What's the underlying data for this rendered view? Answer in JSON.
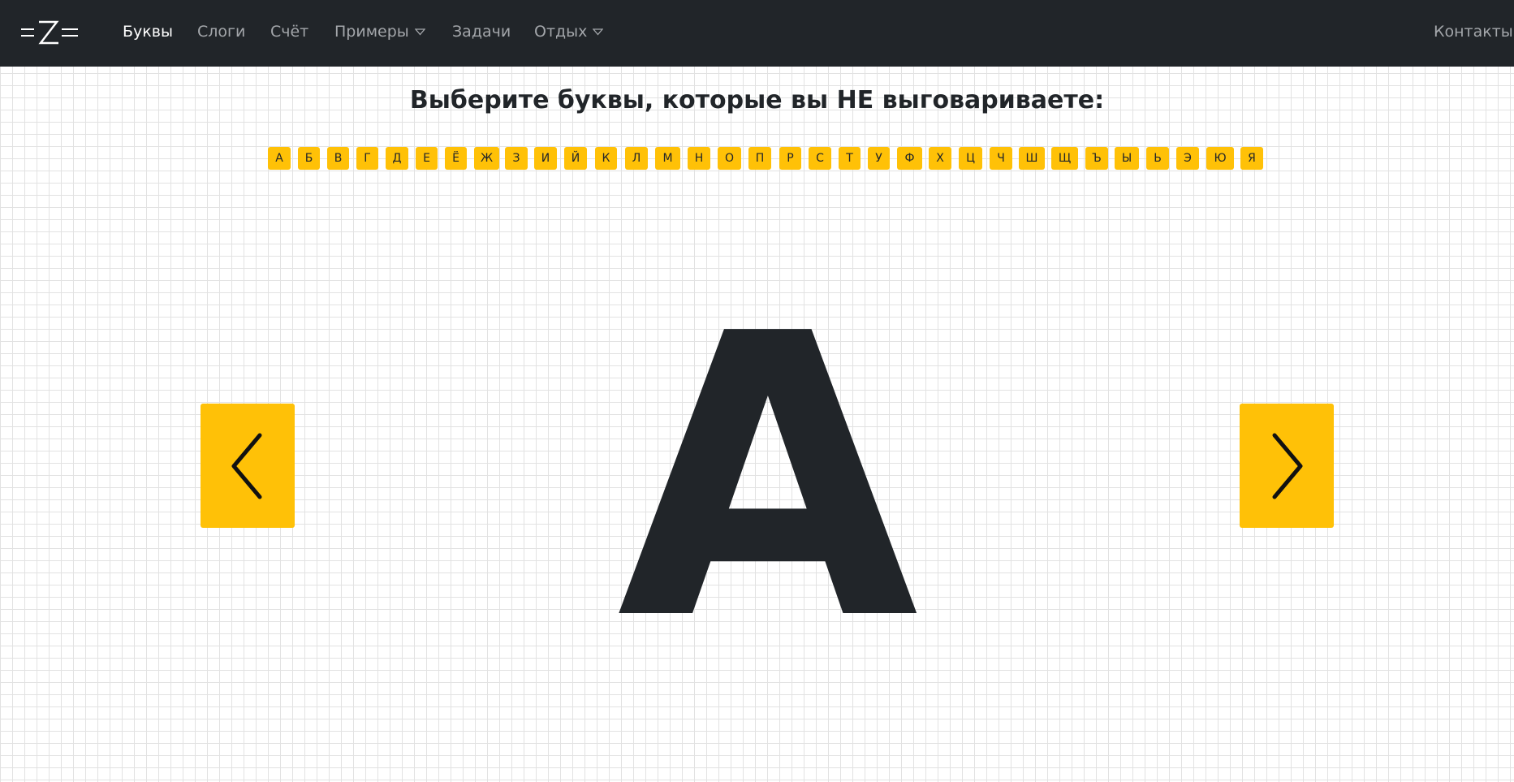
{
  "nav": {
    "logo_label": "=Z=",
    "items": [
      {
        "label": "Буквы",
        "active": true,
        "dropdown": false
      },
      {
        "label": "Слоги",
        "active": false,
        "dropdown": false
      },
      {
        "label": "Счёт",
        "active": false,
        "dropdown": false
      },
      {
        "label": "Примеры",
        "active": false,
        "dropdown": true
      },
      {
        "label": "Задачи",
        "active": false,
        "dropdown": false
      },
      {
        "label": "Отдых",
        "active": false,
        "dropdown": true
      }
    ],
    "contacts_label": "Контакты"
  },
  "title": "Выберите буквы, которые вы НЕ выговариваете:",
  "letters": [
    "А",
    "Б",
    "В",
    "Г",
    "Д",
    "Е",
    "Ё",
    "Ж",
    "З",
    "И",
    "Й",
    "К",
    "Л",
    "М",
    "Н",
    "О",
    "П",
    "Р",
    "С",
    "Т",
    "У",
    "Ф",
    "Х",
    "Ц",
    "Ч",
    "Ш",
    "Щ",
    "Ъ",
    "Ы",
    "Ь",
    "Э",
    "Ю",
    "Я"
  ],
  "current_letter": "А",
  "prev_icon": "chevron-left-icon",
  "next_icon": "chevron-right-icon",
  "colors": {
    "navbar": "#212529",
    "accent": "#ffc107",
    "text": "#212529",
    "nav_inactive": "#a3a6aa",
    "nav_active": "#ffffff"
  }
}
